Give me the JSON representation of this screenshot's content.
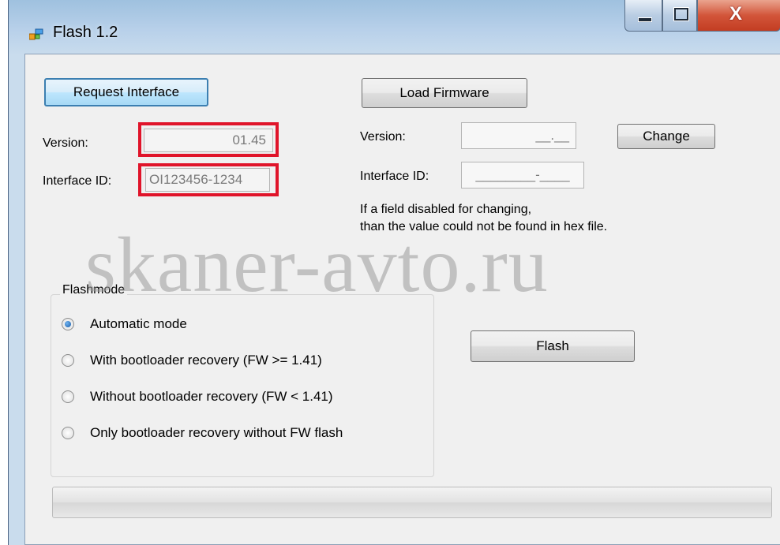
{
  "window": {
    "title": "Flash 1.2"
  },
  "left": {
    "request_button": "Request Interface",
    "version_label": "Version:",
    "version_value": "01.45",
    "interface_label": "Interface ID:",
    "interface_value": "OI123456-1234"
  },
  "right": {
    "load_button": "Load Firmware",
    "version_label": "Version:",
    "version_value": "__.__",
    "change_button": "Change",
    "interface_label": "Interface ID:",
    "interface_value": "________-____",
    "note_line1": "If a field disabled for changing,",
    "note_line2": "than the value could not be found in hex file."
  },
  "flashmode": {
    "title": "Flashmode",
    "options": [
      {
        "label": "Automatic mode",
        "selected": true
      },
      {
        "label": "With bootloader recovery (FW >= 1.41)",
        "selected": false
      },
      {
        "label": "Without bootloader recovery (FW < 1.41)",
        "selected": false
      },
      {
        "label": "Only bootloader recovery without FW flash",
        "selected": false
      }
    ]
  },
  "flash_button": "Flash",
  "progress": {
    "value": 0
  },
  "watermark": "skaner-avto.ru",
  "colors": {
    "highlight": "#e0142a",
    "close_button": "#c33d22"
  }
}
